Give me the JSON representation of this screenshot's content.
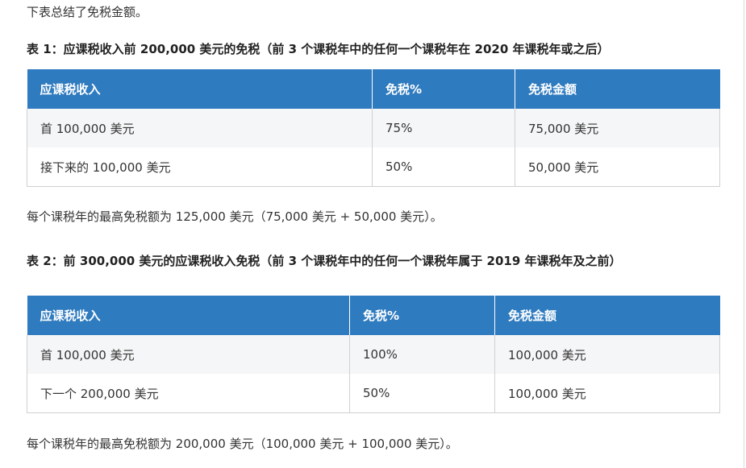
{
  "intro": "下表总结了免税金额。",
  "table1": {
    "caption": "表 1：应课税收入前 200,000 美元的免税（前 3 个课税年中的任何一个课税年在 2020 年课税年或之后）",
    "headers": [
      "应课税收入",
      "免税%",
      "免税金额"
    ],
    "rows": [
      [
        "首 100,000 美元",
        "75%",
        "75,000 美元"
      ],
      [
        "接下来的 100,000 美元",
        "50%",
        "50,000 美元"
      ]
    ],
    "note": "每个课税年的最高免税额为 125,000 美元（75,000 美元 + 50,000 美元）。"
  },
  "table2": {
    "caption": "表 2：前 300,000 美元的应课税收入免税（前 3 个课税年中的任何一个课税年属于 2019 年课税年及之前）",
    "headers": [
      "应课税收入",
      "免税%",
      "免税金额"
    ],
    "rows": [
      [
        "首 100,000 美元",
        "100%",
        "100,000 美元"
      ],
      [
        "下一个 200,000 美元",
        "50%",
        "100,000 美元"
      ]
    ],
    "note": "每个课税年的最高免税额为 200,000 美元（100,000 美元 + 100,000 美元）。"
  },
  "colors": {
    "header_bg": "#2f7bbf",
    "header_text": "#ffffff",
    "row_alt_bg": "#f5f6f7",
    "border": "#d0d0d0"
  }
}
